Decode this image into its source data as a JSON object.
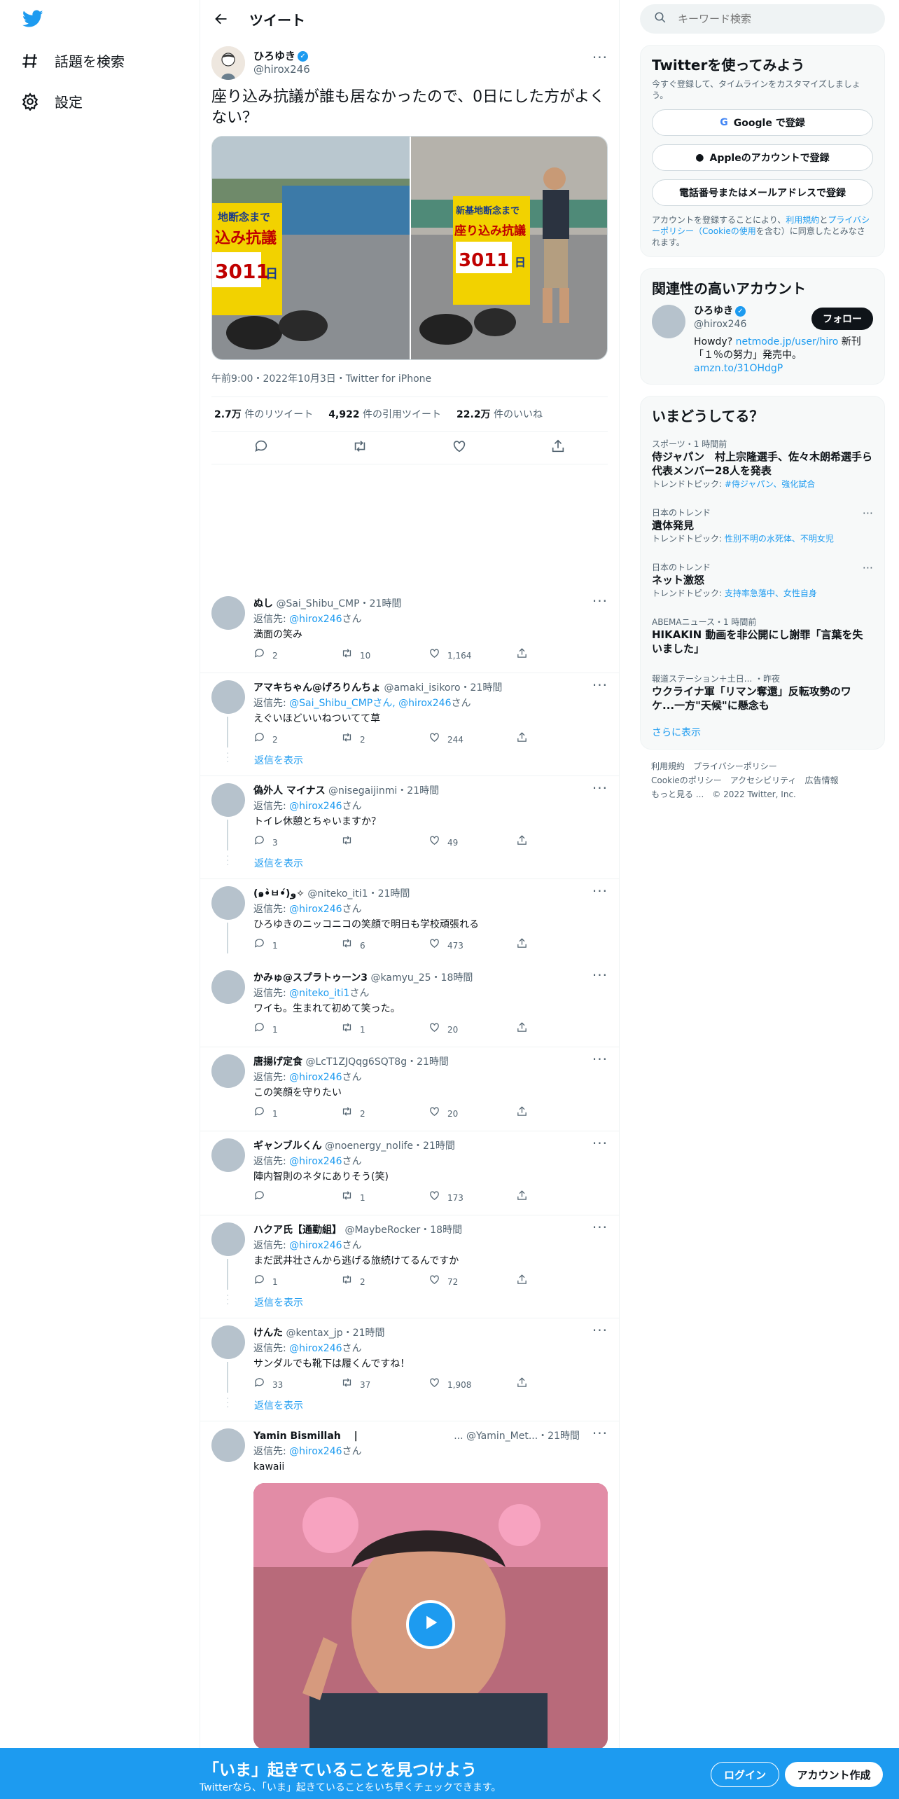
{
  "nav": {
    "explore_label": "話題を検索",
    "settings_label": "設定"
  },
  "header": {
    "title": "ツイート"
  },
  "main_tweet": {
    "display_name": "ひろゆき",
    "handle": "@hirox246",
    "text": "座り込み抗議が誰も居なかったので、0日にした方がよくない？",
    "meta": "午前9:00・2022年10月3日・Twitter for iPhone",
    "sign_left": [
      "地断念まで",
      "込み抗議",
      "3011",
      "日"
    ],
    "sign_right": [
      "新基地断念まで",
      "座り込み抗議",
      "3011",
      "日"
    ],
    "retweets": "2.7万",
    "retweets_label": "件のリツイート",
    "quotes": "4,922",
    "quotes_label": "件の引用ツイート",
    "likes": "22.2万",
    "likes_label": "件のいいね"
  },
  "replies": [
    {
      "name": "ぬし",
      "handle": "@Sai_Shibu_CMP",
      "time": "・21時間",
      "to_prefix": "返信先: ",
      "to": "@hirox246",
      "to_suffix": "さん",
      "text": "満面の笑み",
      "reply": "2",
      "rt": "10",
      "like": "1,164",
      "show_more": ""
    },
    {
      "name": "アマキちゃん@げろりんちょ",
      "handle": "@amaki_isikoro",
      "time": "・21時間",
      "to_prefix": "返信先: ",
      "to": "@Sai_Shibu_CMPさん, @hirox246",
      "to_suffix": "さん",
      "text": "えぐいほどいいねついてて草",
      "reply": "2",
      "rt": "2",
      "like": "244",
      "show_more": "返信を表示"
    },
    {
      "name": "偽外人 マイナス",
      "handle": "@nisegaijinmi",
      "time": "・21時間",
      "to_prefix": "返信先: ",
      "to": "@hirox246",
      "to_suffix": "さん",
      "text": "トイレ休憩とちゃいますか？",
      "reply": "3",
      "rt": "",
      "like": "49",
      "show_more": "返信を表示"
    },
    {
      "name": "(๑•̀ㅂ•́)و✧",
      "handle": "@niteko_iti1",
      "time": "・21時間",
      "to_prefix": "返信先: ",
      "to": "@hirox246",
      "to_suffix": "さん",
      "text": "ひろゆきのニッコニコの笑顔で明日も学校頑張れる",
      "reply": "1",
      "rt": "6",
      "like": "473",
      "show_more": ""
    },
    {
      "name": "かみゅ@スプラトゥーン3",
      "handle": "@kamyu_25",
      "time": "・18時間",
      "to_prefix": "返信先: ",
      "to": "@niteko_iti1",
      "to_suffix": "さん",
      "text": "ワイも。生まれて初めて笑った。",
      "reply": "1",
      "rt": "1",
      "like": "20",
      "show_more": ""
    },
    {
      "name": "唐揚げ定食",
      "handle": "@LcT1ZJQqg6SQT8g",
      "time": "・21時間",
      "to_prefix": "返信先: ",
      "to": "@hirox246",
      "to_suffix": "さん",
      "text": "この笑顔を守りたい",
      "reply": "1",
      "rt": "2",
      "like": "20",
      "show_more": ""
    },
    {
      "name": "ギャンブルくん",
      "handle": "@noenergy_nolife",
      "time": "・21時間",
      "to_prefix": "返信先: ",
      "to": "@hirox246",
      "to_suffix": "さん",
      "text": "陣内智則のネタにありそう(笑)",
      "reply": "",
      "rt": "1",
      "like": "173",
      "show_more": ""
    },
    {
      "name": "ハクア氏【通勤組】",
      "handle": "@MaybeRocker",
      "time": "・18時間",
      "to_prefix": "返信先: ",
      "to": "@hirox246",
      "to_suffix": "さん",
      "text": "まだ武井壮さんから逃げる旅続けてるんですか",
      "reply": "1",
      "rt": "2",
      "like": "72",
      "show_more": "返信を表示"
    },
    {
      "name": "けんた",
      "handle": "@kentax_jp",
      "time": "・21時間",
      "to_prefix": "返信先: ",
      "to": "@hirox246",
      "to_suffix": "さん",
      "text": "サンダルでも靴下は履くんですね！",
      "reply": "33",
      "rt": "37",
      "like": "1,908",
      "show_more": "返信を表示"
    }
  ],
  "last_reply": {
    "name": "Yamin Bismillah　 |",
    "handle": "... @Yamin_Met...",
    "time": "・21時間",
    "to_prefix": "返信先: ",
    "to": "@hirox246",
    "to_suffix": "さん",
    "text": "kawaii"
  },
  "sidebar": {
    "search_placeholder": "キーワード検索",
    "signup": {
      "title": "Twitterを使ってみよう",
      "subtitle": "今すぐ登録して、タイムラインをカスタマイズしましょう。",
      "google": "Google で登録",
      "apple": "Appleのアカウントで登録",
      "phone": "電話番号またはメールアドレスで登録",
      "legal_1": "アカウントを登録することにより、",
      "legal_terms": "利用規約",
      "legal_and": "と",
      "legal_privacy": "プライバシーポリシー（Cookieの使用",
      "legal_2": "を含む）に同意したとみなされます。"
    },
    "related": {
      "title": "関連性の高いアカウント",
      "name": "ひろゆき",
      "handle": "@hirox246",
      "follow": "フォロー",
      "bio_1": "Howdy? ",
      "bio_link": "netmode.jp/user/hiro",
      "bio_2": " 新刊「１％の努力」発売中。",
      "bio_link2": "amzn.to/31OHdgP"
    },
    "trends": {
      "title": "いまどうしてる？",
      "items": [
        {
          "cat": "スポーツ・1 時間前",
          "title": "侍ジャパン　村上宗隆選手、佐々木朗希選手ら代表メンバー28人を発表",
          "sub_prefix": "トレンドトピック: ",
          "sub_link": "#侍ジャパン、強化試合"
        },
        {
          "cat": "日本のトレンド",
          "title": "遺体発見",
          "sub_prefix": "トレンドトピック: ",
          "sub_link": "性別不明の水死体、不明女児"
        },
        {
          "cat": "日本のトレンド",
          "title": "ネット激怒",
          "sub_prefix": "トレンドトピック: ",
          "sub_link": "支持率急落中、女性自身"
        },
        {
          "cat": "ABEMAニュース・1 時間前",
          "title": "HIKAKIN 動画を非公開にし謝罪「言葉を失いました」",
          "sub_prefix": "",
          "sub_link": ""
        },
        {
          "cat": "報道ステーション＋土日... ・昨夜",
          "title": "ウクライナ軍「リマン奪還」反転攻勢のワケ...一方\"天候\"に懸念も",
          "sub_prefix": "",
          "sub_link": ""
        }
      ],
      "more": "さらに表示"
    },
    "footer": {
      "l1": "利用規約",
      "l2": "プライバシーポリシー",
      "l3": "Cookieのポリシー",
      "l4": "アクセシビリティ",
      "l5": "広告情報",
      "l6": "もっと見る ...",
      "l7": "© 2022 Twitter, Inc."
    }
  },
  "banner": {
    "title": "「いま」起きていることを見つけよう",
    "subtitle": "Twitterなら、「いま」起きていることをいち早くチェックできます。",
    "login": "ログイン",
    "signup": "アカウント作成"
  },
  "colors": {
    "accent": "#1d9bf0",
    "text": "#0f1419",
    "muted": "#536471"
  }
}
